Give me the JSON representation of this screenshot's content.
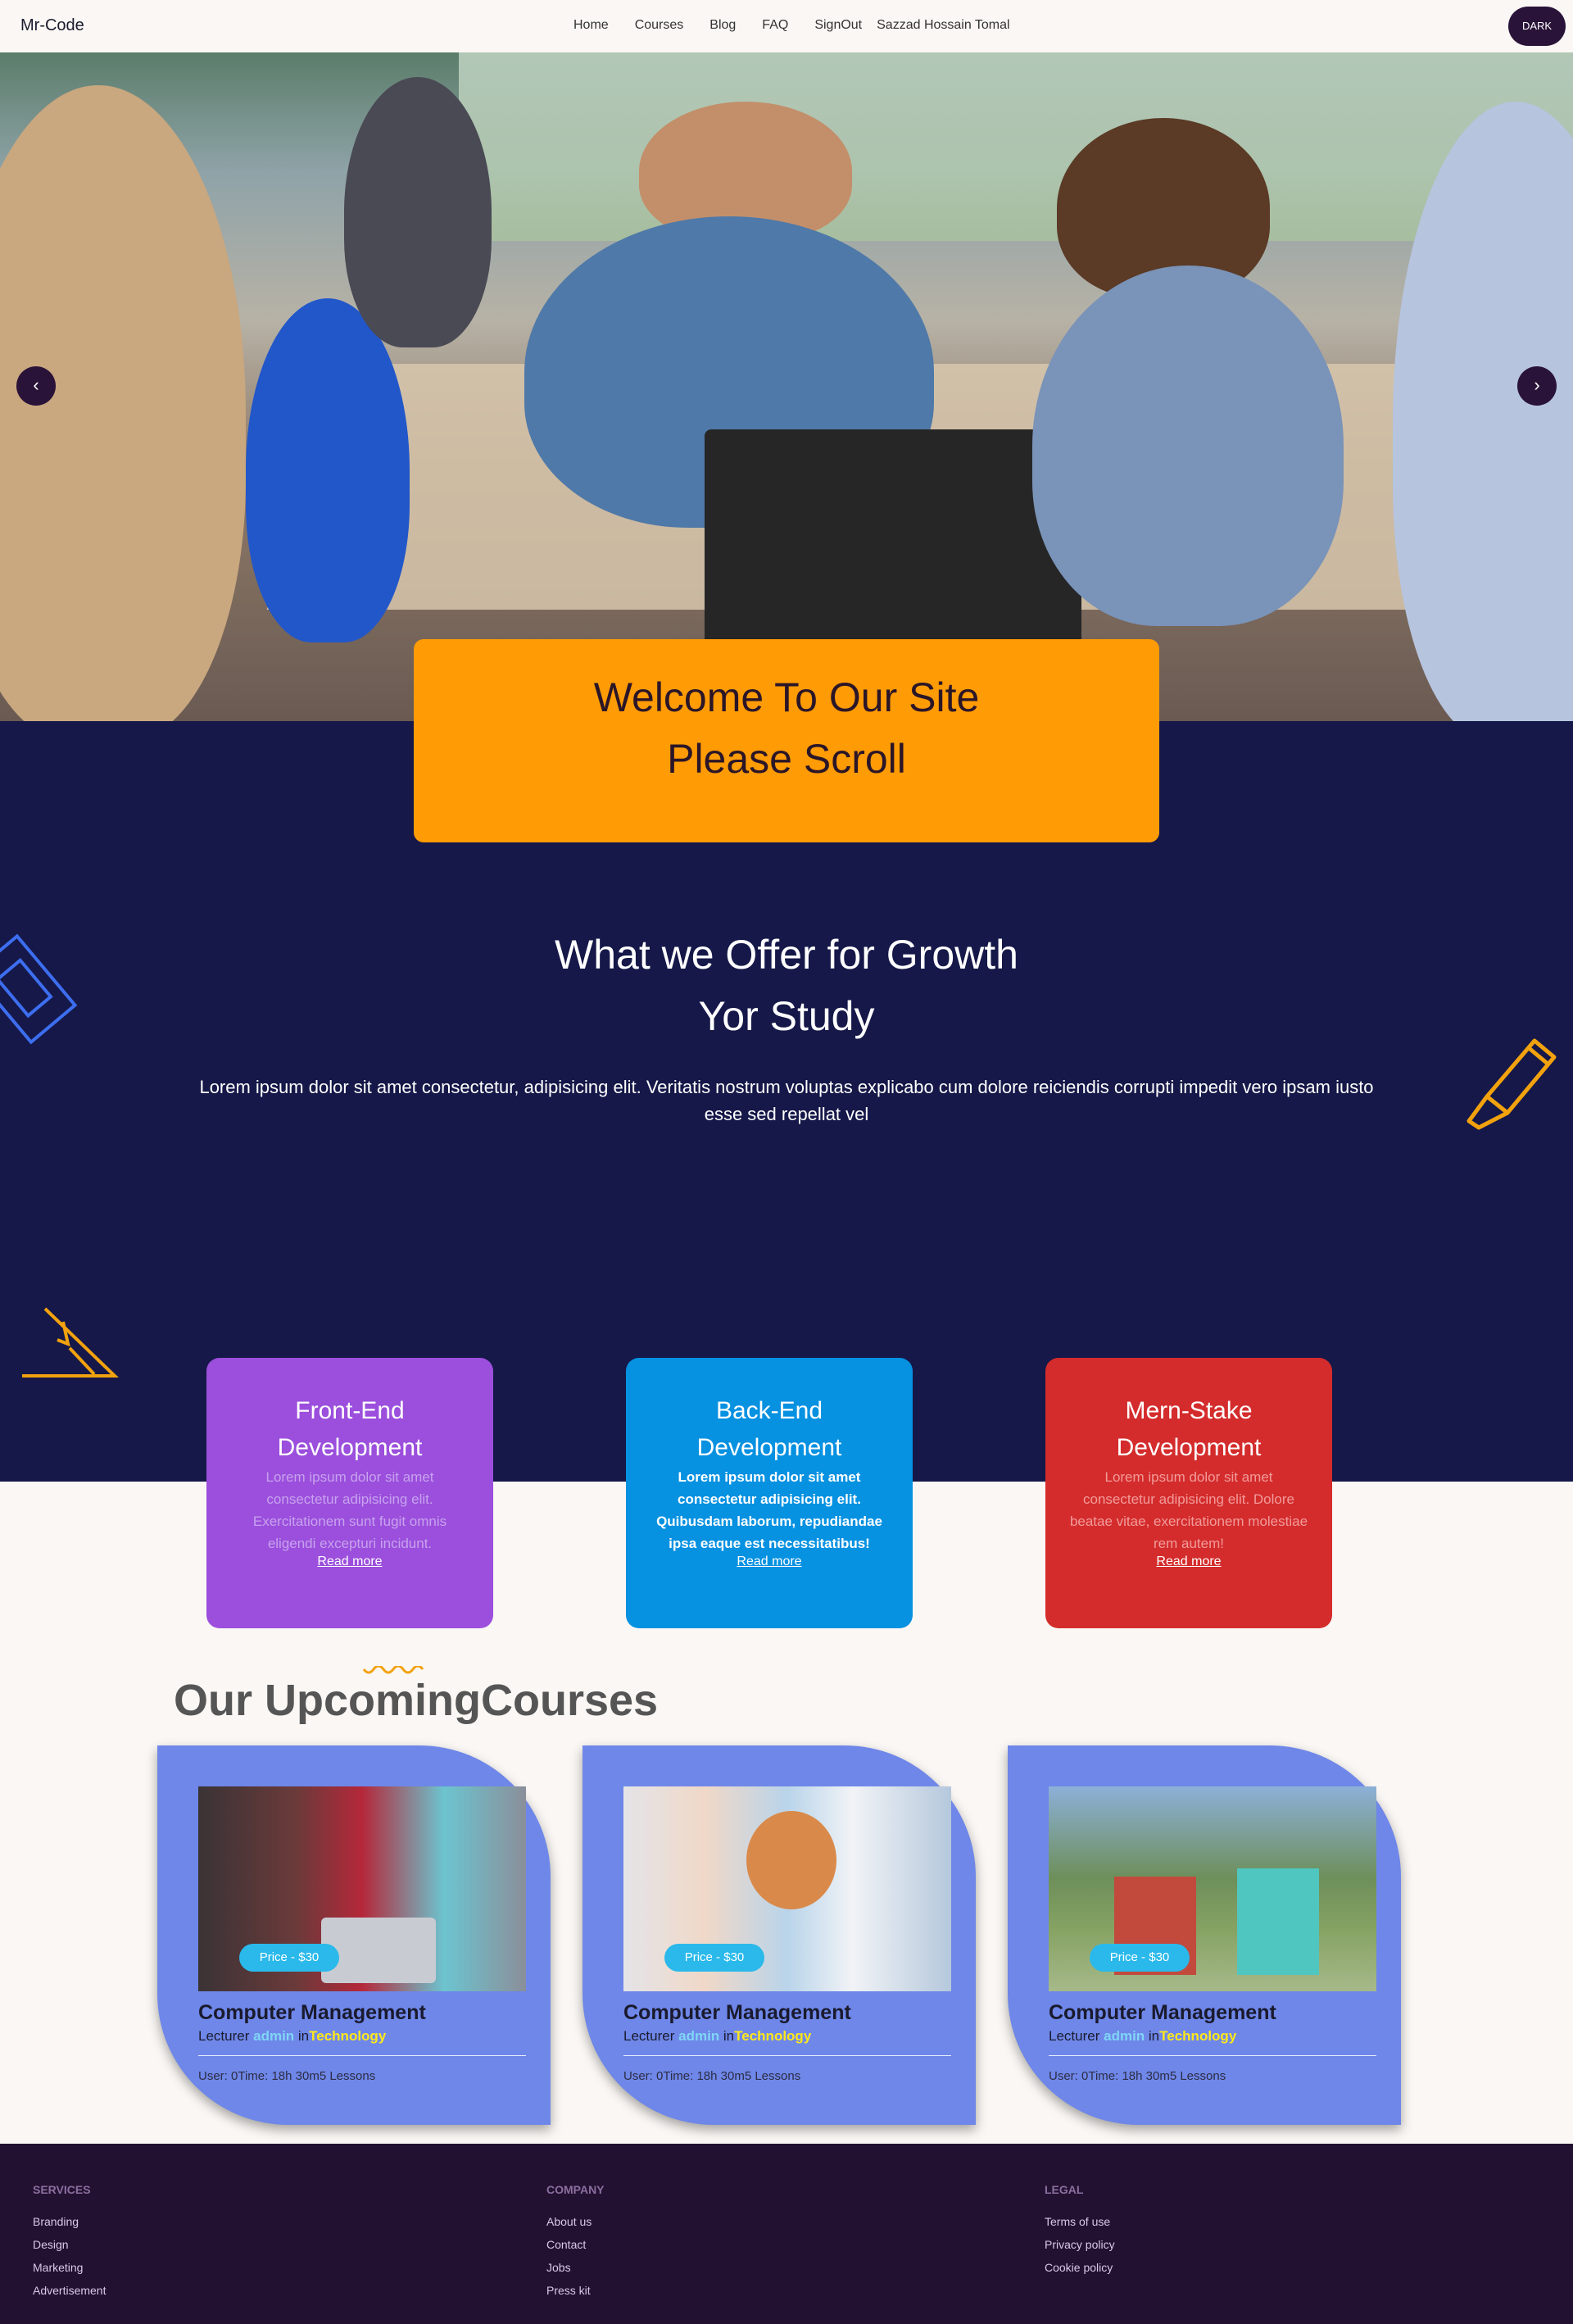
{
  "nav": {
    "brand": "Mr-Code",
    "links": [
      "Home",
      "Courses",
      "Blog",
      "FAQ",
      "SignOut"
    ],
    "user": "Sazzad Hossain Tomal",
    "theme_toggle": "DARK"
  },
  "hero": {
    "prev_icon": "‹",
    "next_icon": "›",
    "welcome_line1": "Welcome To Our Site",
    "welcome_line2": "Please Scroll"
  },
  "offer": {
    "title_line1": "What we Offer for Growth",
    "title_line2": "Yor Study",
    "text": "Lorem ipsum dolor sit amet consectetur, adipisicing elit. Veritatis nostrum voluptas explicabo cum dolore reiciendis corrupti impedit vero ipsam iusto esse sed repellat vel"
  },
  "services": [
    {
      "title": "Front-End Development",
      "text": "Lorem ipsum dolor sit amet consectetur adipisicing elit. Exercitationem sunt fugit omnis eligendi excepturi incidunt.",
      "link": "Read more"
    },
    {
      "title": "Back-End Development",
      "text": "Lorem ipsum dolor sit amet consectetur adipisicing elit. Quibusdam laborum, repudiandae ipsa eaque est necessitatibus!",
      "link": "Read more"
    },
    {
      "title": "Mern-Stake Development",
      "text": "Lorem ipsum dolor sit amet consectetur adipisicing elit. Dolore beatae vitae, exercitationem molestiae rem autem!",
      "link": "Read more"
    }
  ],
  "upcoming": {
    "heading": "Our UpcomingCourses",
    "courses": [
      {
        "price": "Price - $30",
        "title": "Computer Management",
        "lecturer": "Lecturer",
        "author": "admin",
        "in": "in",
        "category": "Technology",
        "footer": "User: 0Time: 18h 30m5 Lessons"
      },
      {
        "price": "Price - $30",
        "title": "Computer Management",
        "lecturer": "Lecturer",
        "author": "admin",
        "in": "in",
        "category": "Technology",
        "footer": "User: 0Time: 18h 30m5 Lessons"
      },
      {
        "price": "Price - $30",
        "title": "Computer Management",
        "lecturer": "Lecturer",
        "author": "admin",
        "in": "in",
        "category": "Technology",
        "footer": "User: 0Time: 18h 30m5 Lessons"
      }
    ]
  },
  "footer": {
    "services": {
      "title": "SERVICES",
      "items": [
        "Branding",
        "Design",
        "Marketing",
        "Advertisement"
      ]
    },
    "company": {
      "title": "COMPANY",
      "items": [
        "About us",
        "Contact",
        "Jobs",
        "Press kit"
      ]
    },
    "legal": {
      "title": "LEGAL",
      "items": [
        "Terms of use",
        "Privacy policy",
        "Cookie policy"
      ]
    }
  },
  "colors": {
    "navy": "#151848",
    "orange": "#ff9b05",
    "purple_card": "#9b4fdc",
    "blue_card": "#0691e1",
    "red_card": "#d42c2c",
    "course_card": "#6e87e8",
    "footer": "#231131"
  }
}
